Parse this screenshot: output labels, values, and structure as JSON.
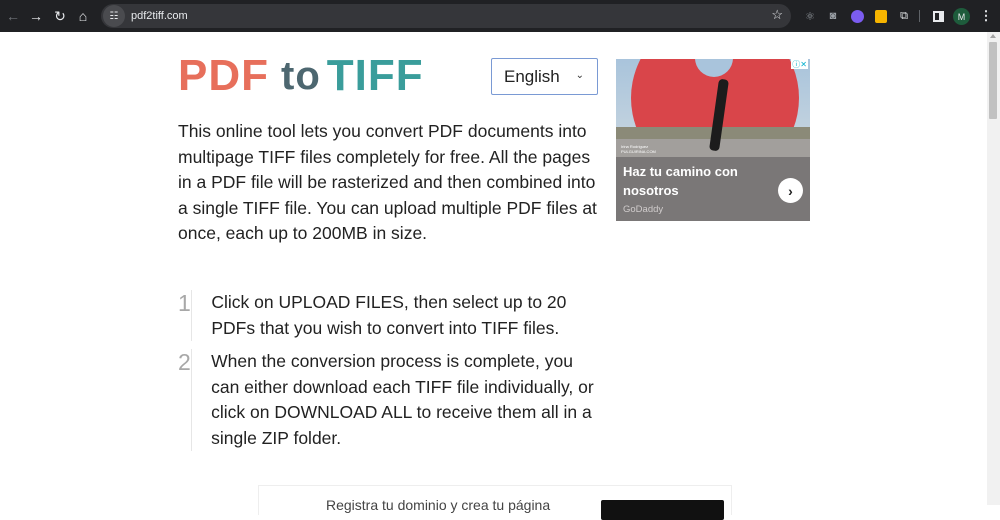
{
  "browser": {
    "url": "pdf2tiff.com",
    "profile_initial": "M",
    "icons": [
      "back-icon",
      "forward-icon",
      "reload-icon",
      "home-icon",
      "site-info-icon",
      "bookmark-star-icon",
      "react-devtools-icon",
      "screenshot-camera-icon",
      "extension-purple-icon",
      "keep-notes-icon",
      "extensions-puzzle-icon",
      "side-panel-icon",
      "profile-avatar",
      "menu-kebab-icon"
    ]
  },
  "logo": {
    "part1": "PDF",
    "part2": "to",
    "part3": "TIFF"
  },
  "language_select": {
    "selected": "English"
  },
  "intro": "This online tool lets you convert PDF documents into multipage TIFF files completely for free. All the pages in a PDF file will be rasterized and then combined into a single TIFF file. You can upload multiple PDF files at once, each up to 200MB in size.",
  "steps": [
    {
      "number": "1",
      "text": "Click on UPLOAD FILES, then select up to 20 PDFs that you wish to convert into TIFF files."
    },
    {
      "number": "2",
      "text": "When the conversion process is complete, you can either download each TIFF file individually, or click on DOWNLOAD ALL to receive them all in a single ZIP folder."
    }
  ],
  "ad": {
    "photo_credit_name": "Irina Rodriguez",
    "photo_credit_site": "PULGUIRINA.COM",
    "headline": "Haz tu camino con nosotros",
    "advertiser": "GoDaddy",
    "adchoices": "ⓘ✕"
  },
  "bottom_ad": {
    "text": "Registra tu dominio y crea tu página"
  },
  "colors": {
    "pdf": "#e76f5b",
    "to": "#4d6770",
    "tiff": "#3a9d9b",
    "chrome_bg": "#202124"
  }
}
